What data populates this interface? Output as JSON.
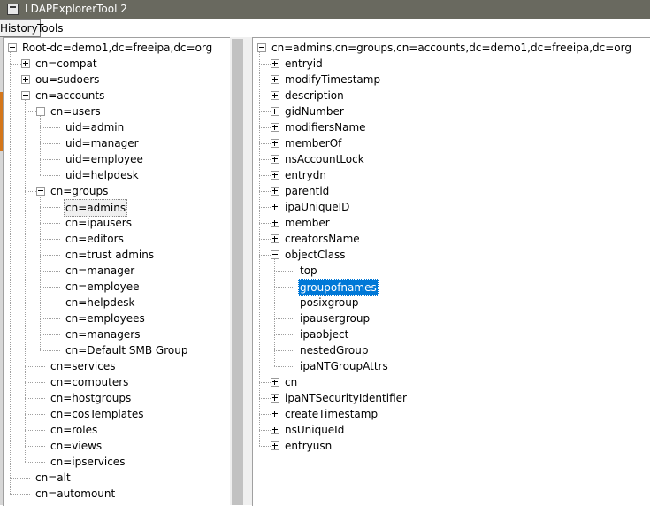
{
  "window": {
    "title": "LDAPExplorerTool 2"
  },
  "menu": {
    "history": "History",
    "tools": "Tools"
  },
  "left_tree": {
    "root": "Root-dc=demo1,dc=freeipa,dc=org",
    "items": [
      {
        "label": "cn=compat",
        "level": 1,
        "state": "collapsed"
      },
      {
        "label": "ou=sudoers",
        "level": 1,
        "state": "collapsed"
      },
      {
        "label": "cn=accounts",
        "level": 1,
        "state": "expanded"
      },
      {
        "label": "cn=users",
        "level": 2,
        "state": "expanded"
      },
      {
        "label": "uid=admin",
        "level": 3,
        "state": "leaf"
      },
      {
        "label": "uid=manager",
        "level": 3,
        "state": "leaf"
      },
      {
        "label": "uid=employee",
        "level": 3,
        "state": "leaf"
      },
      {
        "label": "uid=helpdesk",
        "level": 3,
        "state": "leaf"
      },
      {
        "label": "cn=groups",
        "level": 2,
        "state": "expanded"
      },
      {
        "label": "cn=admins",
        "level": 3,
        "state": "leaf",
        "highlighted": true
      },
      {
        "label": "cn=ipausers",
        "level": 3,
        "state": "leaf"
      },
      {
        "label": "cn=editors",
        "level": 3,
        "state": "leaf"
      },
      {
        "label": "cn=trust admins",
        "level": 3,
        "state": "leaf"
      },
      {
        "label": "cn=manager",
        "level": 3,
        "state": "leaf"
      },
      {
        "label": "cn=employee",
        "level": 3,
        "state": "leaf"
      },
      {
        "label": "cn=helpdesk",
        "level": 3,
        "state": "leaf"
      },
      {
        "label": "cn=employees",
        "level": 3,
        "state": "leaf"
      },
      {
        "label": "cn=managers",
        "level": 3,
        "state": "leaf"
      },
      {
        "label": "cn=Default SMB Group",
        "level": 3,
        "state": "leaf"
      },
      {
        "label": "cn=services",
        "level": 2,
        "state": "leaf"
      },
      {
        "label": "cn=computers",
        "level": 2,
        "state": "leaf"
      },
      {
        "label": "cn=hostgroups",
        "level": 2,
        "state": "leaf"
      },
      {
        "label": "cn=cosTemplates",
        "level": 2,
        "state": "leaf"
      },
      {
        "label": "cn=roles",
        "level": 2,
        "state": "leaf"
      },
      {
        "label": "cn=views",
        "level": 2,
        "state": "leaf"
      },
      {
        "label": "cn=ipservices",
        "level": 2,
        "state": "leaf"
      },
      {
        "label": "cn=alt",
        "level": 1,
        "state": "leaf"
      },
      {
        "label": "cn=automount",
        "level": 1,
        "state": "leaf"
      }
    ]
  },
  "right_tree": {
    "root": "cn=admins,cn=groups,cn=accounts,dc=demo1,dc=freeipa,dc=org",
    "items": [
      {
        "label": "entryid",
        "level": 1,
        "state": "collapsed"
      },
      {
        "label": "modifyTimestamp",
        "level": 1,
        "state": "collapsed"
      },
      {
        "label": "description",
        "level": 1,
        "state": "collapsed"
      },
      {
        "label": "gidNumber",
        "level": 1,
        "state": "collapsed"
      },
      {
        "label": "modifiersName",
        "level": 1,
        "state": "collapsed"
      },
      {
        "label": "memberOf",
        "level": 1,
        "state": "collapsed"
      },
      {
        "label": "nsAccountLock",
        "level": 1,
        "state": "collapsed"
      },
      {
        "label": "entrydn",
        "level": 1,
        "state": "collapsed"
      },
      {
        "label": "parentid",
        "level": 1,
        "state": "collapsed"
      },
      {
        "label": "ipaUniqueID",
        "level": 1,
        "state": "collapsed"
      },
      {
        "label": "member",
        "level": 1,
        "state": "collapsed"
      },
      {
        "label": "creatorsName",
        "level": 1,
        "state": "collapsed"
      },
      {
        "label": "objectClass",
        "level": 1,
        "state": "expanded"
      },
      {
        "label": "top",
        "level": 2,
        "state": "leaf"
      },
      {
        "label": "groupofnames",
        "level": 2,
        "state": "leaf",
        "selected": true
      },
      {
        "label": "posixgroup",
        "level": 2,
        "state": "leaf"
      },
      {
        "label": "ipausergroup",
        "level": 2,
        "state": "leaf"
      },
      {
        "label": "ipaobject",
        "level": 2,
        "state": "leaf"
      },
      {
        "label": "nestedGroup",
        "level": 2,
        "state": "leaf"
      },
      {
        "label": "ipaNTGroupAttrs",
        "level": 2,
        "state": "leaf"
      },
      {
        "label": "cn",
        "level": 1,
        "state": "collapsed"
      },
      {
        "label": "ipaNTSecurityIdentifier",
        "level": 1,
        "state": "collapsed"
      },
      {
        "label": "createTimestamp",
        "level": 1,
        "state": "collapsed"
      },
      {
        "label": "nsUniqueId",
        "level": 1,
        "state": "collapsed"
      },
      {
        "label": "entryusn",
        "level": 1,
        "state": "collapsed"
      }
    ]
  },
  "colors": {
    "titlebar": "#69695f",
    "selection": "#0078d7",
    "accent": "#d4761a"
  }
}
